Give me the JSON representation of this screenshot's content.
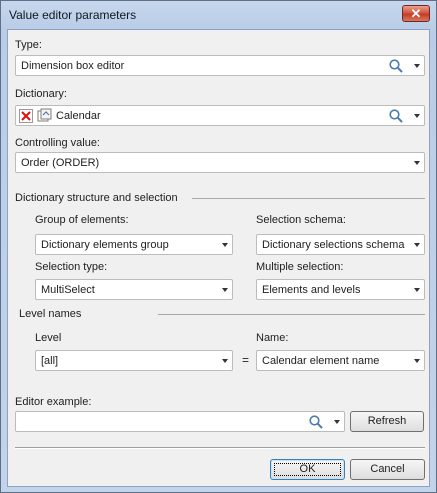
{
  "window": {
    "title": "Value editor parameters",
    "close_glyph": "✕"
  },
  "type": {
    "label": "Type:",
    "value": "Dimension box editor"
  },
  "dictionary": {
    "label": "Dictionary:",
    "value": "Calendar"
  },
  "controlling": {
    "label": "Controlling value:",
    "value": "Order (ORDER)"
  },
  "structure": {
    "heading": "Dictionary structure and selection",
    "group_label": "Group of elements:",
    "group_value": "Dictionary elements group",
    "schema_label": "Selection schema:",
    "schema_value": "Dictionary selections schema",
    "seltype_label": "Selection type:",
    "seltype_value": "MultiSelect",
    "multi_label": "Multiple selection:",
    "multi_value": "Elements and levels"
  },
  "levels": {
    "heading": "Level names",
    "level_label": "Level",
    "level_value": "[all]",
    "equals": "=",
    "name_label": "Name:",
    "name_value": "Calendar element name"
  },
  "example": {
    "label": "Editor example:",
    "value": "",
    "refresh_label": "Refresh"
  },
  "buttons": {
    "ok": "OK",
    "cancel": "Cancel"
  },
  "colors": {
    "accent": "#3c7fb1",
    "close": "#c53c25"
  }
}
